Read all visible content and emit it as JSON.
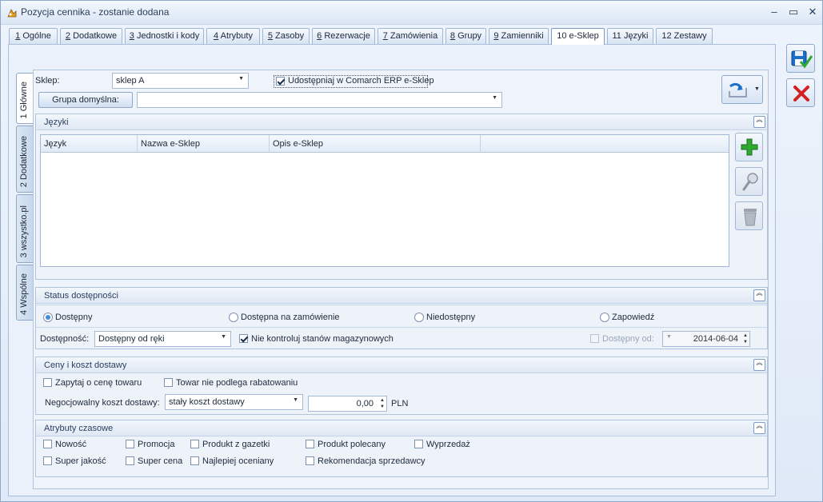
{
  "window": {
    "title": "Pozycja cennika - zostanie dodana"
  },
  "tabs": [
    {
      "key": "1",
      "label": " Ogólne"
    },
    {
      "key": "2",
      "label": " Dodatkowe"
    },
    {
      "key": "3",
      "label": " Jednostki i kody"
    },
    {
      "key": "4",
      "label": " Atrybuty"
    },
    {
      "key": "5",
      "label": " Zasoby"
    },
    {
      "key": "6",
      "label": " Rezerwacje"
    },
    {
      "key": "7",
      "label": " Zamówienia"
    },
    {
      "key": "8",
      "label": " Grupy"
    },
    {
      "key": "9",
      "label": " Zamienniki"
    },
    {
      "key": "",
      "label": "10 e-Sklep"
    },
    {
      "key": "",
      "label": "11 Języki"
    },
    {
      "key": "",
      "label": "12 Zestawy"
    }
  ],
  "vtabs": [
    "1 Główne",
    "2 Dodatkowe",
    "3 wszystko.pl",
    "4 Wspólne"
  ],
  "form": {
    "sklep_label": "Sklep:",
    "sklep_value": "sklep A",
    "udostepniaj_label": "Udostępniaj w Comarch ERP e-Sklep",
    "grupa_button": "Grupa domyślna:",
    "grupa_value": ""
  },
  "jezyki": {
    "title": "Języki",
    "columns": [
      "Język",
      "Nazwa e-Sklep",
      "Opis e-Sklep",
      ""
    ]
  },
  "status": {
    "title": "Status dostępności",
    "radios": [
      "Dostępny",
      "Dostępna na zamówienie",
      "Niedostępny",
      "Zapowiedź"
    ],
    "dostepnosc_label": "Dostępność:",
    "dostepnosc_value": "Dostępny od ręki",
    "nie_kontroluj_label": "Nie kontroluj stanów magazynowych",
    "dostepny_od_label": "Dostępny od:",
    "dostepny_od_value": "2014-06-04"
  },
  "ceny": {
    "title": "Ceny i koszt dostawy",
    "zapytaj_label": "Zapytaj o cenę towaru",
    "rabat_label": "Towar nie podlega rabatowaniu",
    "koszt_label": "Negocjowalny koszt dostawy:",
    "koszt_value": "stały koszt dostawy",
    "kwota_value": "0,00",
    "waluta": "PLN"
  },
  "atrybuty": {
    "title": "Atrybuty czasowe",
    "row1": [
      "Nowość",
      "Promocja",
      "Produkt z gazetki",
      "Produkt polecany",
      "Wyprzedaż"
    ],
    "row2": [
      "Super jakość",
      "Super cena",
      "Najlepiej oceniany",
      "Rekomendacja sprzedawcy"
    ]
  },
  "colors": {
    "save_accent": "#1a6fc9",
    "cancel_accent": "#d42020",
    "add_green": "#2fa82f"
  }
}
